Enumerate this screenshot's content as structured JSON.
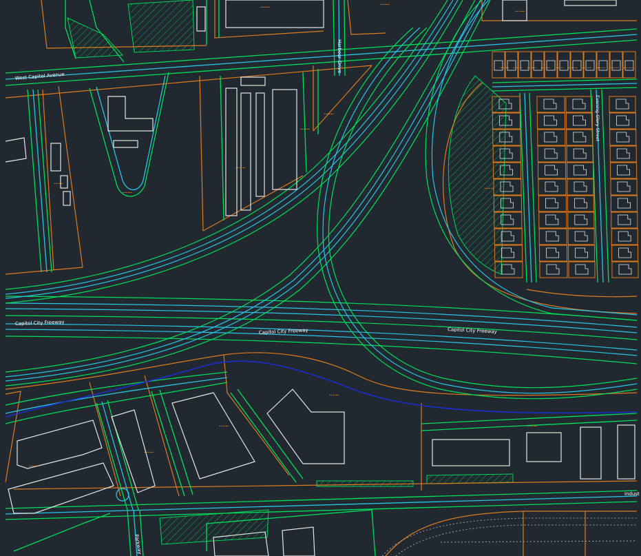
{
  "viewport": {
    "background": "#212830"
  },
  "colors": {
    "road_edge": "#00e05a",
    "road_center": "#29c5e6",
    "parcel": "#e07b1c",
    "building": "#e6e6e6",
    "creek": "#1a2fd1",
    "annotation": "#ff9a1f",
    "rail": "#9aa3b0"
  },
  "street_labels": {
    "west_capitol_avenue": "West Capitol Avenue",
    "harbour_drive": "Harbour Drive",
    "capitol_city_freeway_west": "Capitol City Freeway",
    "capitol_city_freeway_mid": "Capitol City Freeway",
    "capitol_city_freeway_east": "Capitol City Freeway",
    "evening_glory_street": "Evening Glory Street",
    "industrial": "Indust",
    "parkway": "Parkway"
  },
  "parcel_tag_text": "••••••"
}
